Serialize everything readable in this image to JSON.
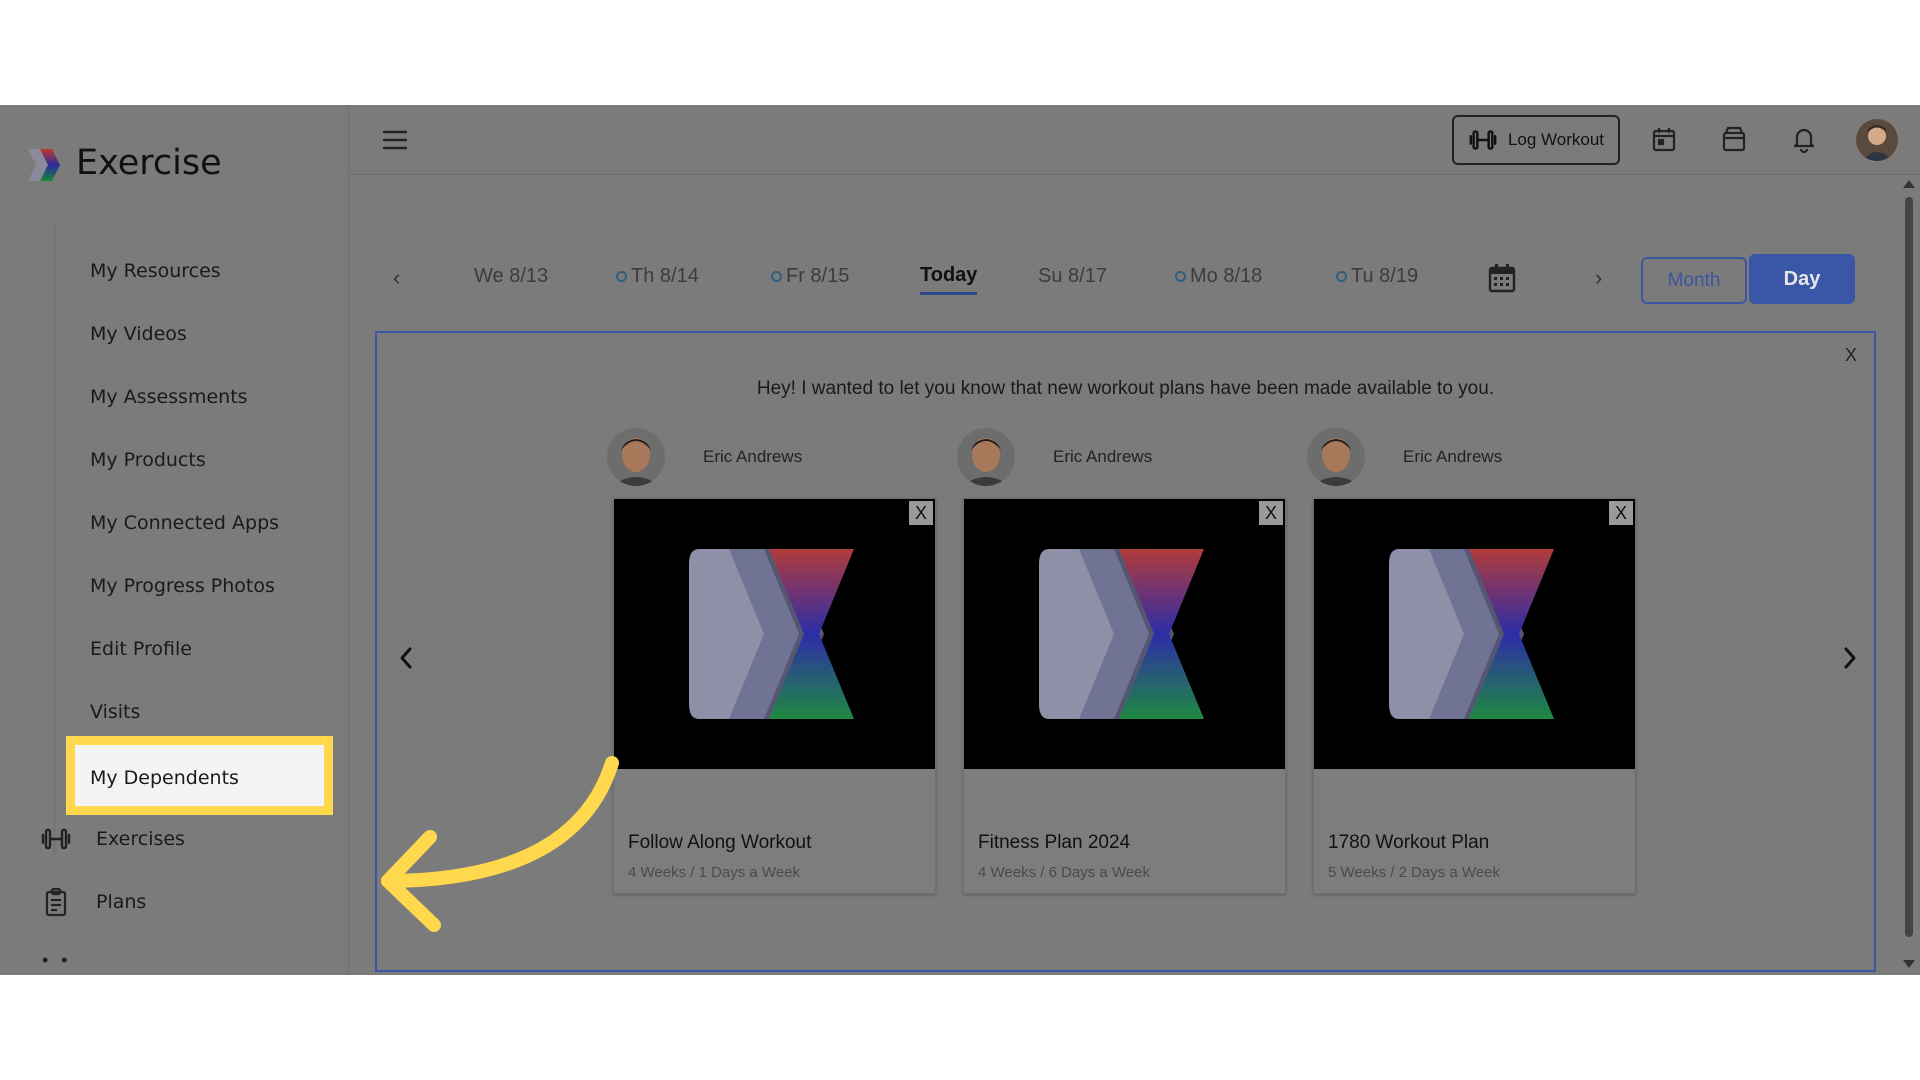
{
  "sidebar": {
    "brand": "Exercise",
    "subnav": [
      "My Resources",
      "My Videos",
      "My Assessments",
      "My Products",
      "My Connected Apps",
      "My Progress Photos",
      "Edit Profile",
      "Visits"
    ],
    "highlighted": "My Dependents",
    "main": [
      {
        "label": "Exercises",
        "icon": "dumbbell-icon"
      },
      {
        "label": "Plans",
        "icon": "clipboard-icon"
      }
    ],
    "more": "• •"
  },
  "topbar": {
    "log_workout": "Log Workout"
  },
  "dates": {
    "prev": "‹",
    "next": "›",
    "items": [
      "We 8/13",
      "Th 8/14",
      "Fr 8/15",
      "Su 8/17",
      "Mo 8/18",
      "Tu 8/19"
    ],
    "today": "Today",
    "month": "Month",
    "day": "Day"
  },
  "panel": {
    "close": "X",
    "message": "Hey! I wanted to let you know that new workout plans have been made available to you.",
    "cards": [
      {
        "author": "Eric Andrews",
        "title": "Follow Along Workout",
        "subtitle": "4 Weeks / 1 Days a Week",
        "close": "X"
      },
      {
        "author": "Eric Andrews",
        "title": "Fitness Plan 2024",
        "subtitle": "4 Weeks / 6 Days a Week",
        "close": "X"
      },
      {
        "author": "Eric Andrews",
        "title": "1780 Workout Plan",
        "subtitle": "5 Weeks / 2 Days a Week",
        "close": "X"
      }
    ]
  },
  "colors": {
    "overlay": "#7b7b7b",
    "accent": "#3a56a6",
    "highlight": "#ffd84d"
  }
}
